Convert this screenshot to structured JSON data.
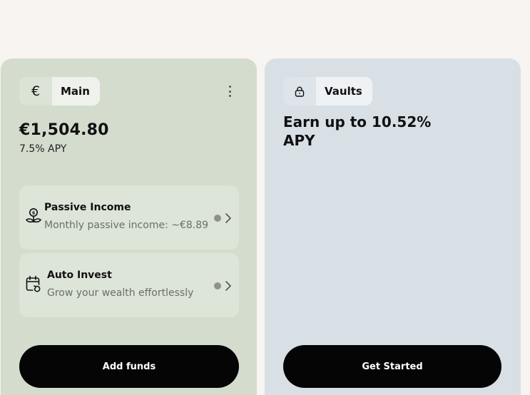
{
  "main_card": {
    "currency_symbol": "€",
    "label": "Main",
    "balance": "€1,504.80",
    "apy": "7.5% APY",
    "features": [
      {
        "title": "Passive Income",
        "subtitle": "Monthly passive income: ~€8.89",
        "icon": "plant-coin-icon"
      },
      {
        "title": "Auto Invest",
        "subtitle": "Grow your wealth effortlessly",
        "icon": "calendar-repeat-icon"
      }
    ],
    "action_label": "Add funds"
  },
  "vaults_card": {
    "label": "Vaults",
    "icon": "lock-icon",
    "headline": "Earn up to 10.52% APY",
    "action_label": "Get Started"
  },
  "colors": {
    "page_background": "#f7f4f1",
    "main_card_background": "#d4dcce",
    "vaults_card_background": "#d8e0e6",
    "button_background": "#050505",
    "button_text": "#ffffff",
    "muted_text": "#6b7068",
    "status_dot": "#8e928b"
  }
}
